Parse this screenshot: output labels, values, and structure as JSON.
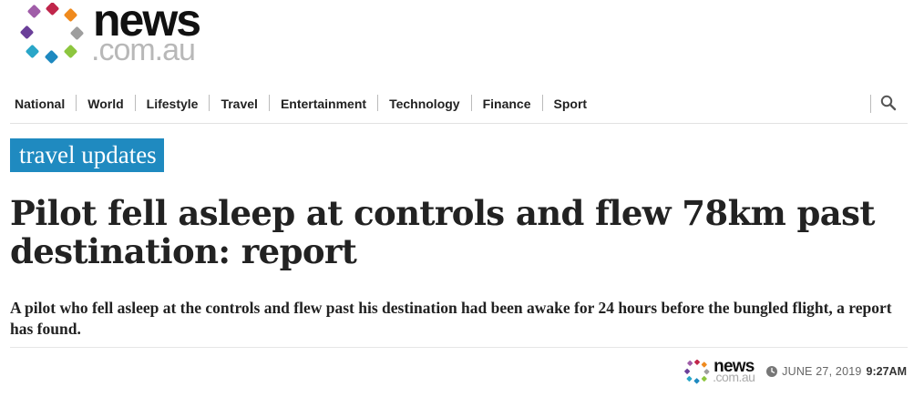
{
  "site": {
    "logo_word": "news",
    "logo_domain": ".com.au",
    "brand_colors": [
      "#c0264b",
      "#ef8a1e",
      "#8dc63f",
      "#2aa6c8",
      "#1e89c0",
      "#6b3f99",
      "#a05da8",
      "#9e9e9e"
    ]
  },
  "nav": {
    "items": [
      {
        "label": "National"
      },
      {
        "label": "World"
      },
      {
        "label": "Lifestyle"
      },
      {
        "label": "Travel"
      },
      {
        "label": "Entertainment"
      },
      {
        "label": "Technology"
      },
      {
        "label": "Finance"
      },
      {
        "label": "Sport"
      }
    ],
    "search_icon": "search-icon"
  },
  "article": {
    "tag": "travel updates",
    "tag_color": "#1f8ac0",
    "headline": "Pilot fell asleep at controls and flew 78km past destination: report",
    "standfirst": "A pilot who fell asleep at the controls and flew past his destination had been awake for 24 hours before the bungled flight, a report has found.",
    "byline": {
      "source_word": "news",
      "source_domain": ".com.au",
      "clock_icon": "clock-icon",
      "date": "JUNE 27, 2019",
      "time": "9:27AM"
    }
  }
}
